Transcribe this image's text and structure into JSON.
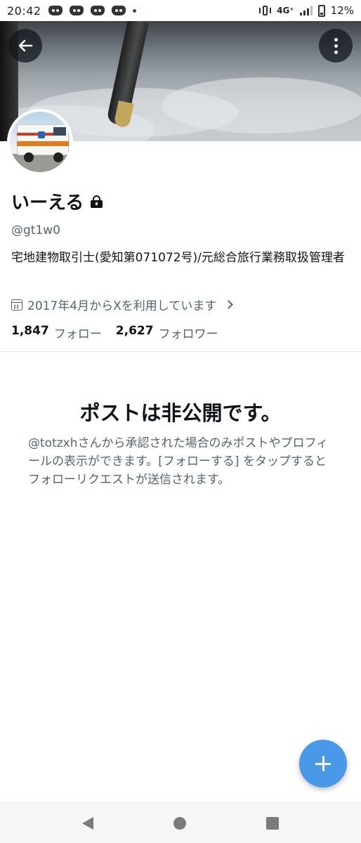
{
  "status_bar": {
    "time": "20:42",
    "network": "4G⁺",
    "battery": "12%",
    "notification_icons": [
      "discord-icon",
      "discord-icon",
      "discord-icon",
      "discord-icon"
    ]
  },
  "profile": {
    "display_name": "いーえる",
    "handle": "@gt1w0",
    "bio": "宅地建物取引士(愛知第071072号)/元総合旅行業務取扱管理者",
    "joined": "2017年4月からXを利用しています",
    "following_count": "1,847",
    "following_label": "フォロー",
    "followers_count": "2,627",
    "followers_label": "フォロワー"
  },
  "private_notice": {
    "title": "ポストは非公開です。",
    "body": "@totzxhさんから承認された場合のみポストやプロフィールの表示ができます。[フォローする] をタップするとフォローリクエストが送信されます。"
  },
  "colors": {
    "accent": "#4a99e9",
    "secondary_text": "#536471",
    "primary_text": "#0f1419"
  }
}
